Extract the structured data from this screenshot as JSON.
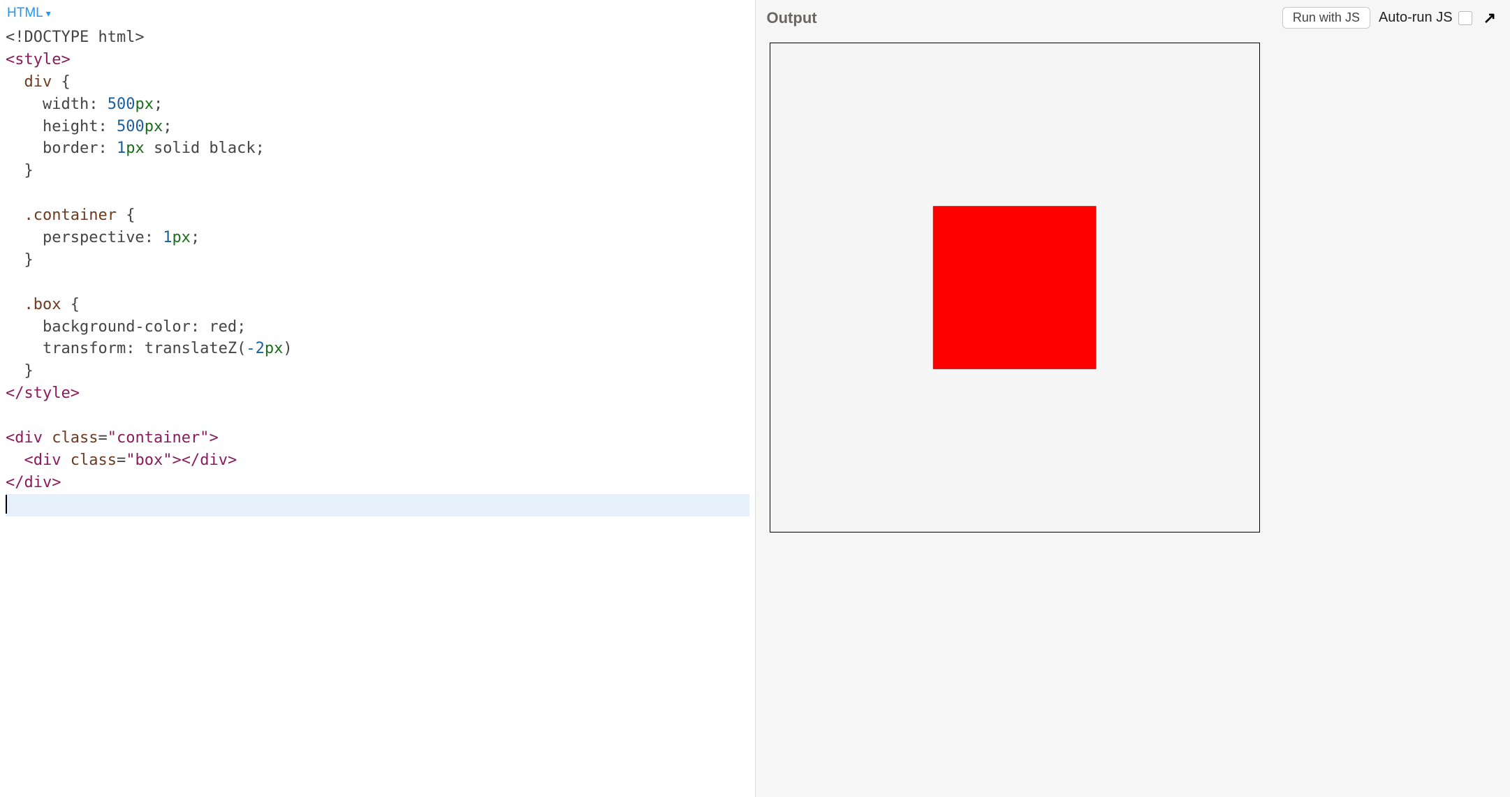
{
  "editor": {
    "language_label": "HTML",
    "code_lines": [
      {
        "type": "doctype",
        "text": "<!DOCTYPE html>"
      },
      {
        "type": "tag-open",
        "tag": "style"
      },
      {
        "type": "css-selector",
        "indent": 1,
        "selector": "div",
        "brace": "{"
      },
      {
        "type": "css-decl",
        "indent": 2,
        "prop": "width",
        "num": "500",
        "unit": "px",
        "term": ";"
      },
      {
        "type": "css-decl",
        "indent": 2,
        "prop": "height",
        "num": "500",
        "unit": "px",
        "term": ";"
      },
      {
        "type": "css-decl-border",
        "indent": 2,
        "prop": "border",
        "num": "1",
        "unit": "px",
        "mid": " solid black",
        "term": ";"
      },
      {
        "type": "css-brace-close",
        "indent": 1
      },
      {
        "type": "blank"
      },
      {
        "type": "css-selector",
        "indent": 1,
        "selector": ".container",
        "brace": "{"
      },
      {
        "type": "css-decl",
        "indent": 2,
        "prop": "perspective",
        "num": "1",
        "unit": "px",
        "term": ";"
      },
      {
        "type": "css-brace-close",
        "indent": 1
      },
      {
        "type": "blank"
      },
      {
        "type": "css-selector",
        "indent": 1,
        "selector": ".box",
        "brace": "{"
      },
      {
        "type": "css-decl-plain",
        "indent": 2,
        "prop": "background-color",
        "val": "red",
        "term": ";"
      },
      {
        "type": "css-decl-func",
        "indent": 2,
        "prop": "transform",
        "func": "translateZ",
        "num": "-2",
        "unit": "px",
        "term": ""
      },
      {
        "type": "css-brace-close",
        "indent": 1
      },
      {
        "type": "tag-close",
        "tag": "style"
      },
      {
        "type": "blank"
      },
      {
        "type": "html-open-attr",
        "tag": "div",
        "attr": "class",
        "val": "container"
      },
      {
        "type": "html-open-attr-close",
        "indent": 1,
        "tag": "div",
        "attr": "class",
        "val": "box",
        "closetag": "div"
      },
      {
        "type": "tag-close",
        "tag": "div"
      },
      {
        "type": "cursor"
      }
    ]
  },
  "output": {
    "title": "Output",
    "run_button": "Run with JS",
    "autorun_label": "Auto-run JS",
    "autorun_checked": false
  },
  "preview": {
    "container_border": "1px solid black",
    "box_color": "red"
  }
}
